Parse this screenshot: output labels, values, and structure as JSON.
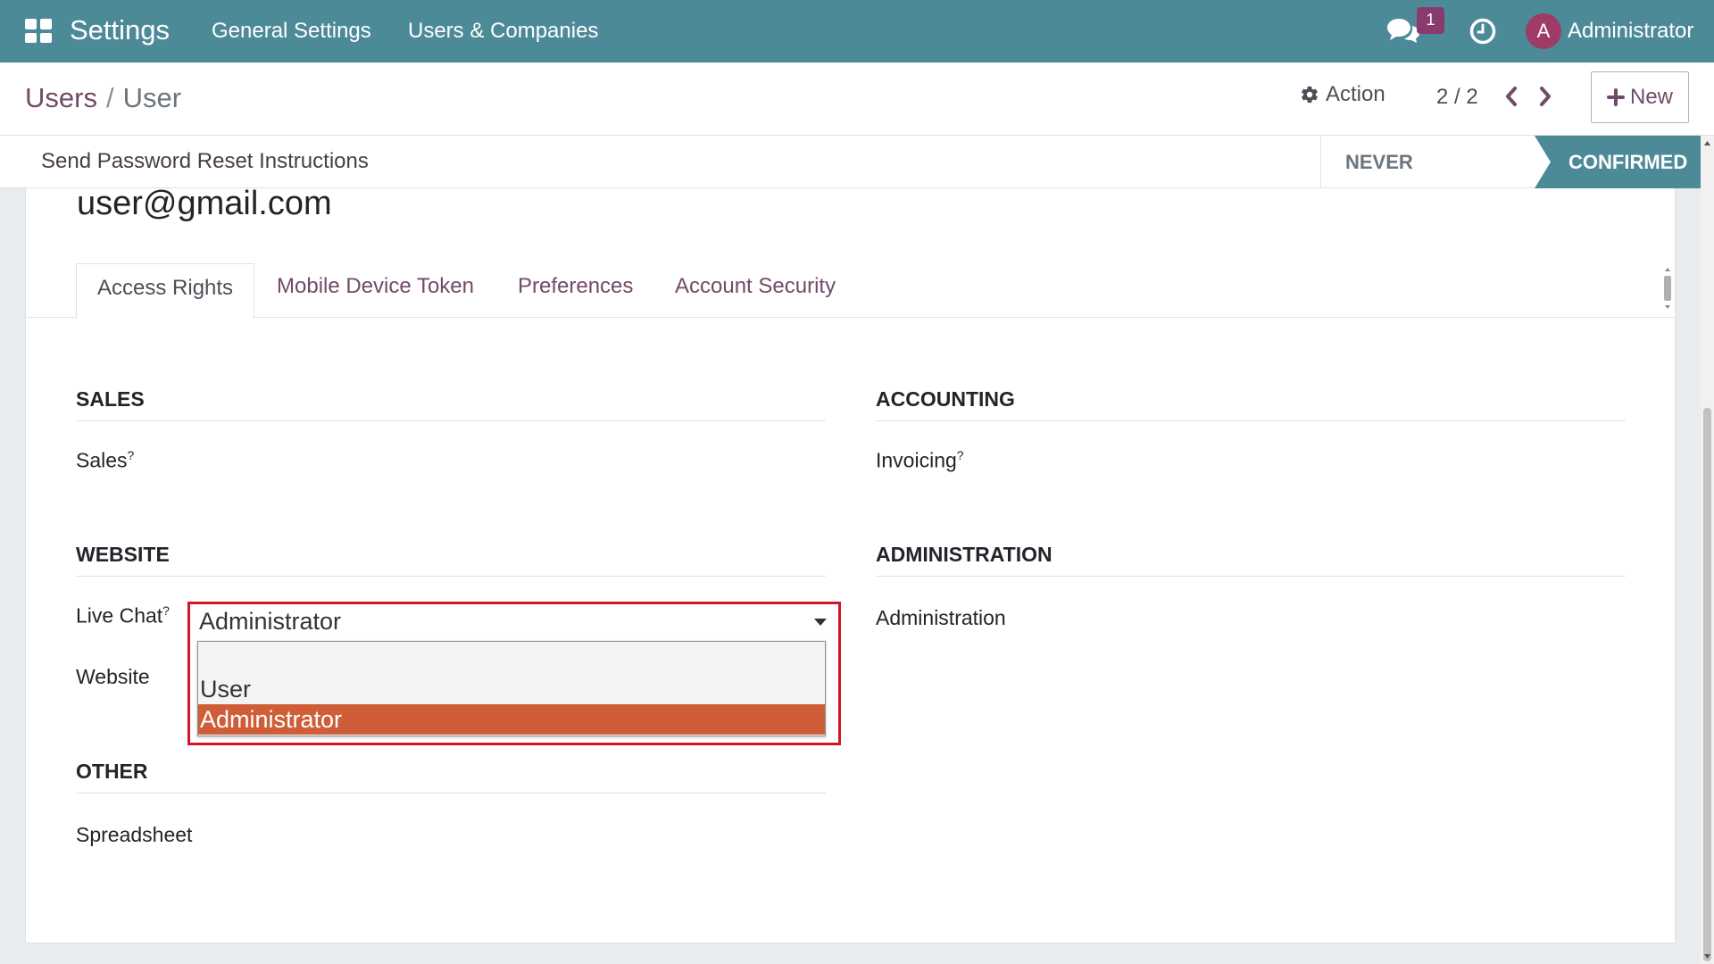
{
  "navbar": {
    "app_title": "Settings",
    "menu": [
      "General Settings",
      "Users & Companies"
    ],
    "chat_badge": "1",
    "avatar_letter": "A",
    "user_name": "Administrator"
  },
  "control_panel": {
    "breadcrumb_parent": "Users",
    "breadcrumb_sep": "/",
    "breadcrumb_current": "User",
    "action_label": "Action",
    "pager": "2 / 2",
    "new_label": "New"
  },
  "statusbar": {
    "reset_label": "Send Password Reset Instructions",
    "stage_never": "NEVER CONNECTED",
    "stage_confirmed": "CONFIRMED"
  },
  "form": {
    "email": "user@gmail.com",
    "tabs": [
      "Access Rights",
      "Mobile Device Token",
      "Preferences",
      "Account Security"
    ],
    "groups": {
      "sales": {
        "title": "SALES",
        "fields": [
          "Sales"
        ]
      },
      "accounting": {
        "title": "ACCOUNTING",
        "fields": [
          "Invoicing"
        ]
      },
      "website": {
        "title": "WEBSITE",
        "fields": [
          "Live Chat",
          "Website"
        ]
      },
      "administration": {
        "title": "ADMINISTRATION",
        "fields": [
          "Administration"
        ]
      },
      "other": {
        "title": "OTHER",
        "fields": [
          "Spreadsheet"
        ]
      }
    },
    "help_mark": "?",
    "live_chat_select": {
      "value": "Administrator",
      "options": [
        "",
        "User",
        "Administrator"
      ]
    }
  },
  "colors": {
    "navbar": "#4c8a97",
    "brand": "#714b67",
    "highlight_border": "#d3152a",
    "selected_option": "#cf5e38"
  }
}
